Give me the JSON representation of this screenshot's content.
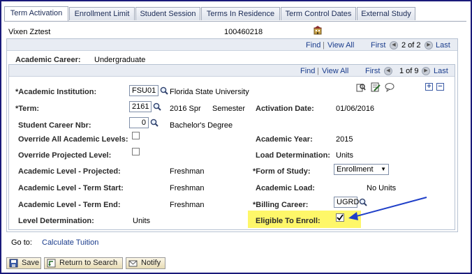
{
  "tabs": [
    {
      "label": "Term Activation"
    },
    {
      "label": "Enrollment Limit"
    },
    {
      "label": "Student Session"
    },
    {
      "label": "Terms In Residence"
    },
    {
      "label": "Term Control Dates"
    },
    {
      "label": "External Study"
    }
  ],
  "student": {
    "name": "Vixen Zztest",
    "id": "100460218"
  },
  "career_nav": {
    "find": "Find",
    "view_all": "View All",
    "first": "First",
    "count": "2 of 2",
    "last": "Last"
  },
  "career": {
    "label": "Academic Career:",
    "value": "Undergraduate"
  },
  "term_nav": {
    "find": "Find",
    "view_all": "View All",
    "first": "First",
    "count": "1 of 9",
    "last": "Last"
  },
  "form": {
    "institution_label": "*Academic Institution:",
    "institution_value": "FSU01",
    "institution_desc": "Florida State University",
    "term_label": "*Term:",
    "term_value": "2161",
    "term_desc": "2016 Spr",
    "term_type": "Semester",
    "activation_date_label": "Activation Date:",
    "activation_date_value": "01/06/2016",
    "career_nbr_label": "Student Career Nbr:",
    "career_nbr_value": "0",
    "career_nbr_desc": "Bachelor's Degree",
    "override_levels_label": "Override All Academic Levels:",
    "academic_year_label": "Academic Year:",
    "academic_year_value": "2015",
    "override_projected_label": "Override Projected Level:",
    "load_determination_label": "Load Determination:",
    "load_determination_value": "Units",
    "level_projected_label": "Academic Level - Projected:",
    "level_projected_value": "Freshman",
    "form_of_study_label": "*Form of Study:",
    "form_of_study_value": "Enrollment",
    "level_term_start_label": "Academic Level - Term Start:",
    "level_term_start_value": "Freshman",
    "academic_load_label": "Academic Load:",
    "academic_load_value": "No Units",
    "level_term_end_label": "Academic Level - Term End:",
    "level_term_end_value": "Freshman",
    "billing_career_label": "*Billing Career:",
    "billing_career_value": "UGRD",
    "level_determination_label": "Level Determination:",
    "level_determination_value": "Units",
    "eligible_label": "Eligible To Enroll:",
    "eligible_checked": true
  },
  "goto": {
    "label": "Go to:",
    "link": "Calculate Tuition"
  },
  "buttons": {
    "save": "Save",
    "return": "Return to Search",
    "notify": "Notify"
  },
  "colors": {
    "highlight": "#fef769",
    "arrow": "#1f3fc8",
    "link": "#1a3c8c",
    "frame": "#1a1a7a"
  }
}
